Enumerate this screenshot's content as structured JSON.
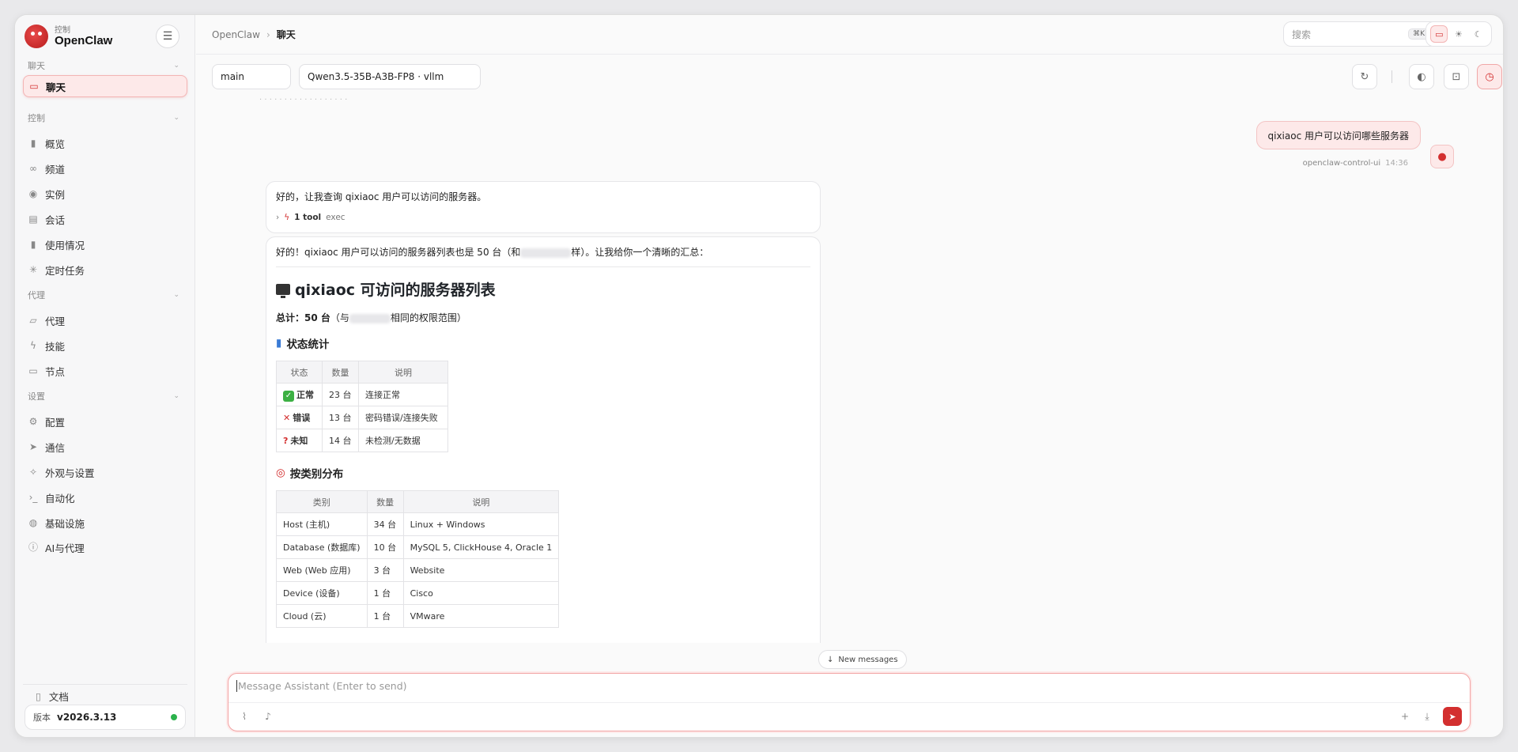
{
  "brand": {
    "sub": "控制",
    "name": "OpenClaw"
  },
  "sidebar": {
    "sections": [
      {
        "title": "聊天",
        "items": [
          {
            "label": "聊天",
            "icon": "chat-icon"
          }
        ]
      },
      {
        "title": "控制",
        "items": [
          {
            "label": "概览",
            "icon": "bar-chart-icon"
          },
          {
            "label": "频道",
            "icon": "link-icon"
          },
          {
            "label": "实例",
            "icon": "broadcast-icon"
          },
          {
            "label": "会话",
            "icon": "document-icon"
          },
          {
            "label": "使用情况",
            "icon": "bar-chart-icon"
          },
          {
            "label": "定时任务",
            "icon": "loader-icon"
          }
        ]
      },
      {
        "title": "代理",
        "items": [
          {
            "label": "代理",
            "icon": "folder-icon"
          },
          {
            "label": "技能",
            "icon": "bolt-icon"
          },
          {
            "label": "节点",
            "icon": "monitor-icon"
          }
        ]
      },
      {
        "title": "设置",
        "items": [
          {
            "label": "配置",
            "icon": "gear-icon"
          },
          {
            "label": "通信",
            "icon": "send-icon"
          },
          {
            "label": "外观与设置",
            "icon": "sparkle-icon"
          },
          {
            "label": "自动化",
            "icon": "terminal-icon"
          },
          {
            "label": "基础设施",
            "icon": "globe-icon"
          },
          {
            "label": "AI与代理",
            "icon": "info-icon"
          }
        ]
      }
    ],
    "docs_label": "文档",
    "version_label": "版本",
    "version_value": "v2026.3.13",
    "status_color": "#2bb24c"
  },
  "topbar": {
    "breadcrumb_root": "OpenClaw",
    "breadcrumb_current": "聊天",
    "search_placeholder": "搜索",
    "search_shortcut": "⌘K"
  },
  "toolbar": {
    "session": "main",
    "model": "Qwen3.5-35B-A3B-FP8 · vllm"
  },
  "chat": {
    "user_message": "qixiaoc 用户可以访问哪些服务器",
    "user_name": "openclaw-control-ui",
    "user_time": "14:36",
    "reply1_text": "好的，让我查询 qixiaoc 用户可以访问的服务器。",
    "reply1_tool_count": "1 tool",
    "reply1_tool_name": "exec",
    "reply2_intro_a": "好的！qixiaoc 用户可以访问的服务器列表也是 50 台（和",
    "reply2_intro_b": "样）。让我给你一个清晰的汇总：",
    "heading": "qixiaoc 可访问的服务器列表",
    "total_label": "总计：",
    "total_value": "50 台",
    "total_a": "（与",
    "total_b": "相同的权限范围）",
    "status_heading": "状态统计",
    "status_table": {
      "headers": [
        "状态",
        "数量",
        "说明"
      ],
      "rows": [
        [
          "正常",
          "23 台",
          "连接正常"
        ],
        [
          "错误",
          "13 台",
          "密码错误/连接失败"
        ],
        [
          "未知",
          "14 台",
          "未检测/无数据"
        ]
      ]
    },
    "category_heading": "按类别分布",
    "category_table": {
      "headers": [
        "类别",
        "数量",
        "说明"
      ],
      "rows": [
        [
          "Host (主机)",
          "34 台",
          "Linux + Windows"
        ],
        [
          "Database (数据库)",
          "10 台",
          "MySQL 5, ClickHouse 4, Oracle 1"
        ],
        [
          "Web (Web 应用)",
          "3 台",
          "Website"
        ],
        [
          "Device (设备)",
          "1 台",
          "Cisco"
        ],
        [
          "Cloud (云)",
          "1 台",
          "VMware"
        ]
      ]
    },
    "new_messages": "New messages"
  },
  "composer": {
    "placeholder": "Message Assistant (Enter to send)"
  },
  "colors": {
    "accent": "#d32f2f",
    "accent_bg": "#fde9e9"
  }
}
